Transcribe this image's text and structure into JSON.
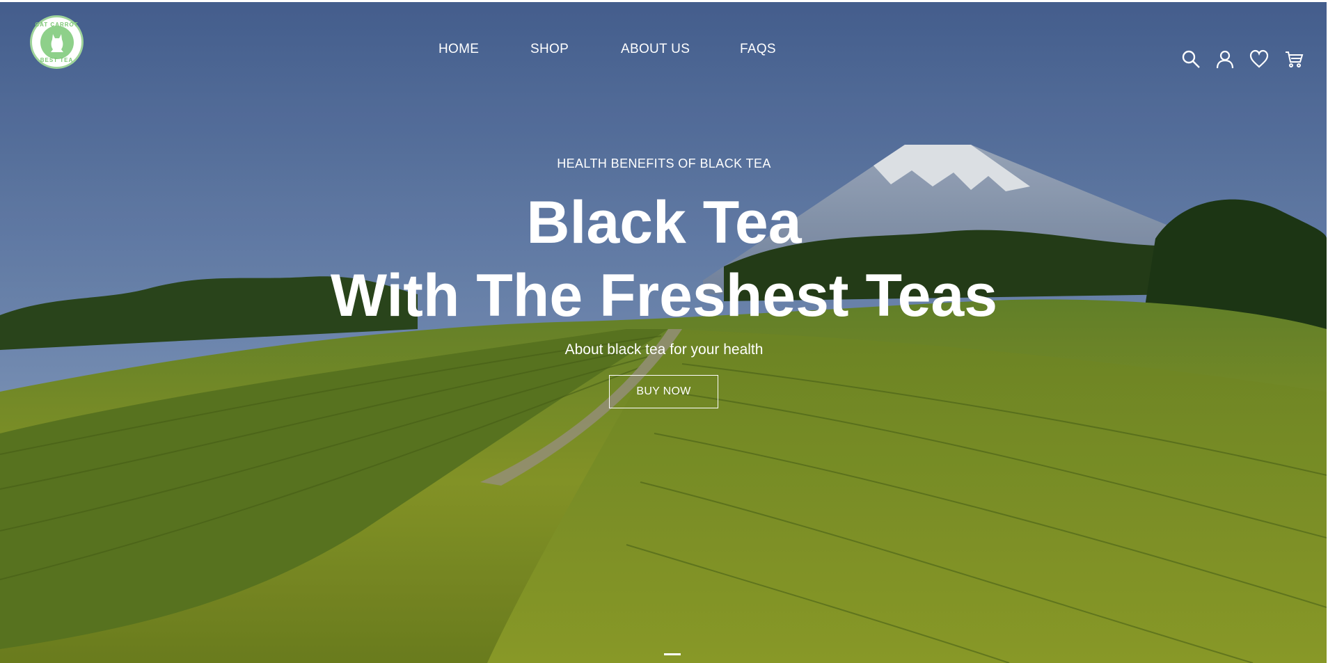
{
  "brand": {
    "logo_top_text": "CAT CARROT",
    "logo_bottom_text": "BEST TEA"
  },
  "nav": {
    "items": [
      {
        "label": "HOME"
      },
      {
        "label": "SHOP"
      },
      {
        "label": "ABOUT US"
      },
      {
        "label": "FAQS"
      }
    ]
  },
  "header_icons": [
    "search-icon",
    "user-icon",
    "heart-icon",
    "cart-icon"
  ],
  "hero": {
    "eyebrow": "HEALTH BENEFITS OF BLACK TEA",
    "title_line1": "Black Tea",
    "title_line2": "With The Freshest Teas",
    "subtitle": "About black tea for your health",
    "cta_label": "BUY NOW"
  },
  "colors": {
    "logo_green": "#8ed08a",
    "text": "#ffffff"
  }
}
